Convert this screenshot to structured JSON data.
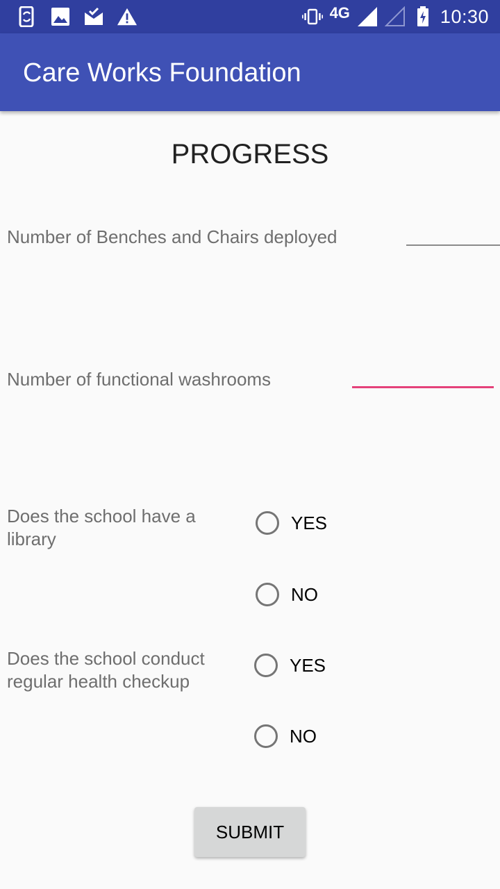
{
  "status_bar": {
    "network": "4G",
    "time": "10:30",
    "left_icons": [
      "phone-sync-icon",
      "image-icon",
      "mail-check-icon",
      "warning-icon"
    ],
    "right_icons": [
      "vibrate-icon",
      "signal-full-icon",
      "signal-empty-icon",
      "battery-charging-icon"
    ]
  },
  "app_bar": {
    "title": "Care Works Foundation",
    "color": "#3F51B5",
    "status_color": "#303F9F"
  },
  "form": {
    "heading": "PROGRESS",
    "benches": {
      "label": "Number of Benches and Chairs deployed",
      "value": ""
    },
    "washrooms": {
      "label": "Number of functional washrooms",
      "value": "",
      "focused": true,
      "accent_color": "#E4417A"
    },
    "library": {
      "question": "Does the school have a library",
      "options": [
        "YES",
        "NO"
      ],
      "selected": null
    },
    "health": {
      "question": "Does the school conduct regular health checkup",
      "options": [
        "YES",
        "NO"
      ],
      "selected": null
    },
    "submit_label": "SUBMIT"
  }
}
